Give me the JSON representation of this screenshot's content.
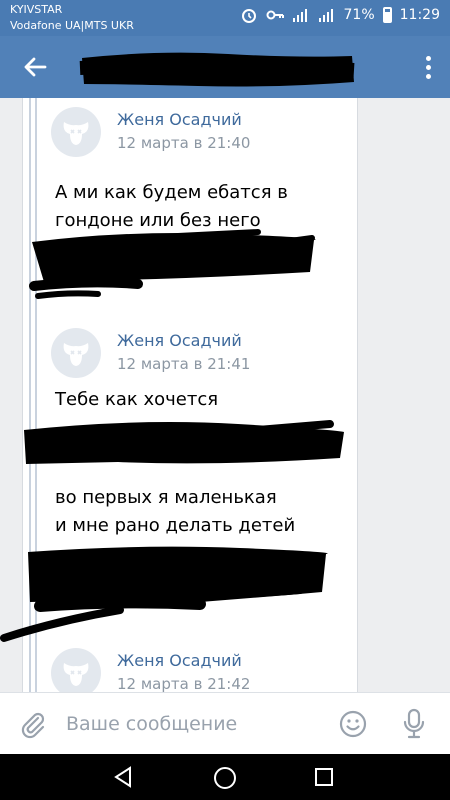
{
  "status_bar": {
    "carrier_1": "KYIVSTAR",
    "carrier_2": "Vodafone UA|MTS UKR",
    "battery": "71%",
    "time": "11:29"
  },
  "header": {
    "title": "",
    "accent_color": "#5181b8"
  },
  "messages": [
    {
      "author": "Женя Осадчий",
      "time": "12 марта в 21:40",
      "lines": [
        "А ми как будем ебатся в",
        "гондоне или без него"
      ]
    },
    {
      "author": "Женя Осадчий",
      "time": "12 марта в 21:41",
      "lines": [
        "Тебе как хочется"
      ]
    },
    {
      "lines": [
        "во первых я маленькая",
        "и мне рано делать детей"
      ]
    },
    {
      "author": "Женя Осадчий",
      "time": "12 марта в 21:42"
    }
  ],
  "input": {
    "placeholder": "Ваше сообщение"
  },
  "icons": [
    "back-arrow-icon",
    "more-vertical-icon",
    "paperclip-icon",
    "emoji-icon",
    "microphone-icon",
    "nav-back-icon",
    "nav-home-icon",
    "nav-recent-icon"
  ]
}
